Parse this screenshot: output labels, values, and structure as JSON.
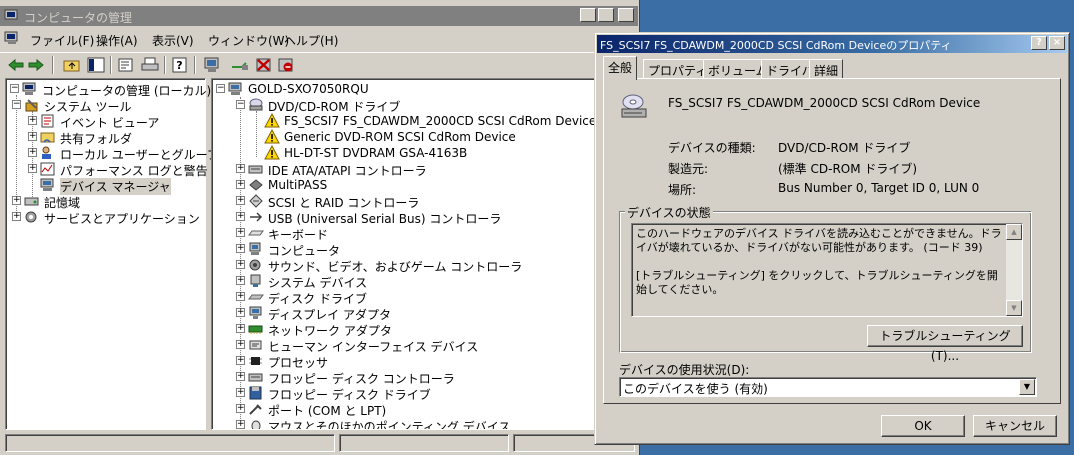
{
  "main": {
    "title": "コンピュータの管理",
    "menu": [
      "ファイル(F)",
      "操作(A)",
      "表示(V)",
      "ウィンドウ(W)",
      "ヘルプ(H)"
    ],
    "caption_buttons": {
      "minimize": "_",
      "restore": "□",
      "close": "×"
    },
    "left_tree": [
      {
        "label": "コンピュータの管理 (ローカル)",
        "icon": "computer-management-icon",
        "expander": "−",
        "level": 0
      },
      {
        "label": "システム ツール",
        "icon": "system-tools-icon",
        "expander": "−",
        "level": 1
      },
      {
        "label": "イベント ビューア",
        "icon": "event-viewer-icon",
        "expander": "+",
        "level": 2
      },
      {
        "label": "共有フォルダ",
        "icon": "shared-folders-icon",
        "expander": "+",
        "level": 2
      },
      {
        "label": "ローカル ユーザーとグループ",
        "icon": "users-icon",
        "expander": "+",
        "level": 2
      },
      {
        "label": "パフォーマンス ログと警告",
        "icon": "performance-icon",
        "expander": "+",
        "level": 2
      },
      {
        "label": "デバイス マネージャ",
        "icon": "device-manager-icon",
        "expander": "",
        "level": 2,
        "selected": true
      },
      {
        "label": "記憶域",
        "icon": "storage-icon",
        "expander": "+",
        "level": 1
      },
      {
        "label": "サービスとアプリケーション",
        "icon": "services-icon",
        "expander": "+",
        "level": 1
      }
    ],
    "right_tree": [
      {
        "label": "GOLD-SXO7050RQU",
        "icon": "computer-icon",
        "expander": "−",
        "level": 0
      },
      {
        "label": "DVD/CD-ROM ドライブ",
        "icon": "cdrom-icon",
        "expander": "−",
        "level": 1
      },
      {
        "label": "FS_SCSI7 FS_CDAWDM_2000CD SCSI CdRom Device",
        "icon": "warning-icon",
        "expander": "",
        "level": 2
      },
      {
        "label": "Generic DVD-ROM SCSI CdRom Device",
        "icon": "warning-icon",
        "expander": "",
        "level": 2
      },
      {
        "label": "HL-DT-ST DVDRAM GSA-4163B",
        "icon": "warning-icon",
        "expander": "",
        "level": 2
      },
      {
        "label": "IDE ATA/ATAPI コントローラ",
        "icon": "ide-controller-icon",
        "expander": "+",
        "level": 1
      },
      {
        "label": "MultiPASS",
        "icon": "multipass-icon",
        "expander": "+",
        "level": 1
      },
      {
        "label": "SCSI と RAID コントローラ",
        "icon": "scsi-icon",
        "expander": "+",
        "level": 1
      },
      {
        "label": "USB (Universal Serial Bus) コントローラ",
        "icon": "usb-icon",
        "expander": "+",
        "level": 1
      },
      {
        "label": "キーボード",
        "icon": "keyboard-icon",
        "expander": "+",
        "level": 1
      },
      {
        "label": "コンピュータ",
        "icon": "computer-icon",
        "expander": "+",
        "level": 1
      },
      {
        "label": "サウンド、ビデオ、およびゲーム コントローラ",
        "icon": "sound-icon",
        "expander": "+",
        "level": 1
      },
      {
        "label": "システム デバイス",
        "icon": "system-device-icon",
        "expander": "+",
        "level": 1
      },
      {
        "label": "ディスク ドライブ",
        "icon": "disk-drive-icon",
        "expander": "+",
        "level": 1
      },
      {
        "label": "ディスプレイ アダプタ",
        "icon": "display-adapter-icon",
        "expander": "+",
        "level": 1
      },
      {
        "label": "ネットワーク アダプタ",
        "icon": "network-adapter-icon",
        "expander": "+",
        "level": 1
      },
      {
        "label": "ヒューマン インターフェイス デバイス",
        "icon": "hid-icon",
        "expander": "+",
        "level": 1
      },
      {
        "label": "プロセッサ",
        "icon": "processor-icon",
        "expander": "+",
        "level": 1
      },
      {
        "label": "フロッピー ディスク コントローラ",
        "icon": "floppy-controller-icon",
        "expander": "+",
        "level": 1
      },
      {
        "label": "フロッピー ディスク ドライブ",
        "icon": "floppy-drive-icon",
        "expander": "+",
        "level": 1
      },
      {
        "label": "ポート (COM と LPT)",
        "icon": "port-icon",
        "expander": "+",
        "level": 1
      },
      {
        "label": "マウスとそのほかのポインティング デバイス",
        "icon": "mouse-icon",
        "expander": "+",
        "level": 1
      }
    ]
  },
  "dialog": {
    "title": "FS_SCSI7 FS_CDAWDM_2000CD SCSI CdRom Deviceのプロパティ",
    "help_button": "?",
    "close_button": "×",
    "tabs": [
      "全般",
      "プロパティ",
      "ボリューム",
      "ドライバ",
      "詳細"
    ],
    "active_tab": 0,
    "device_name": "FS_SCSI7 FS_CDAWDM_2000CD SCSI CdRom Device",
    "fields": [
      {
        "label": "デバイスの種類:",
        "value": "DVD/CD-ROM ドライブ"
      },
      {
        "label": "製造元:",
        "value": "(標準 CD-ROM ドライブ)"
      },
      {
        "label": "場所:",
        "value": "Bus Number 0, Target ID 0, LUN 0"
      }
    ],
    "status_group_label": "デバイスの状態",
    "status_line1": "このハードウェアのデバイス ドライバを読み込むことができません。ドライバが壊れているか、ドライバがない可能性があります。 (コード 39)",
    "status_line2": "[トラブルシューティング] をクリックして、トラブルシューティングを開始してください。",
    "troubleshoot_button": "トラブルシューティング(T)...",
    "usage_label": "デバイスの使用状況(D):",
    "usage_value": "このデバイスを使う (有効)",
    "ok_button": "OK",
    "cancel_button": "キャンセル"
  },
  "colors": {
    "desktop": "#3a6ea5",
    "face": "#d4d0c8",
    "active_title_start": "#0a246a",
    "active_title_end": "#a6caf0",
    "inactive_title": "#808080"
  }
}
